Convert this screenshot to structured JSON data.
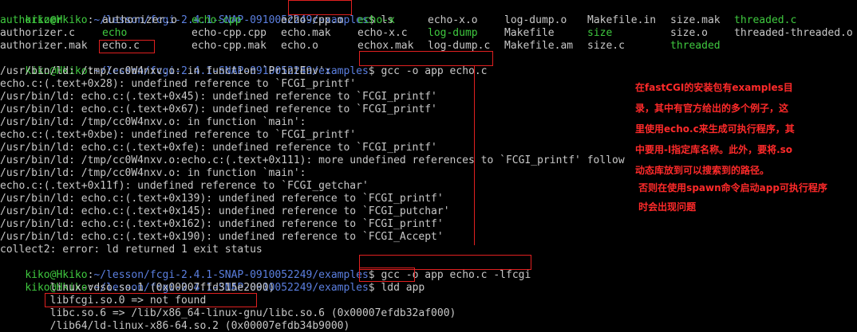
{
  "terminal": {
    "prompt1": {
      "user": "kiko@Hkiko",
      "sep": ":",
      "path": "~/lesson/fcgi-2.4.1-SNAP-0910052249/",
      "path_hl": "examples",
      "dollar": "$ ",
      "cmd": "ls"
    },
    "ls_rows": [
      [
        "authorizer",
        "authorizer.o",
        "echo-cpp",
        "echo-cpp.o",
        "echo-x",
        "echo-x.o",
        "log-dump.o",
        "Makefile.in",
        "size.mak",
        "threaded.c"
      ],
      [
        "authorizer.c",
        "echo",
        "echo-cpp.cpp",
        "echo.mak",
        "echo-x.c",
        "log-dump",
        "Makefile",
        "size",
        "size.o",
        "threaded-threaded.o"
      ],
      [
        "authorizer.mak",
        "echo.c",
        "echo-cpp.mak",
        "echo.o",
        "echox.mak",
        "log-dump.c",
        "Makefile.am",
        "size.c",
        "threaded",
        ""
      ]
    ],
    "prompt2": {
      "user": "kiko@Hkiko",
      "sep": ":",
      "path": "~/lesson/fcgi-2.4.1-SNAP-0910052249/examples",
      "dollar": "$ ",
      "cmd": "gcc -o app echo.c"
    },
    "errors": [
      "/usr/bin/ld: /tmp/cc0W4nxv.o: in function `PrintEnv':",
      "echo.c:(.text+0x28): undefined reference to `FCGI_printf'",
      "/usr/bin/ld: echo.c:(.text+0x45): undefined reference to `FCGI_printf'",
      "/usr/bin/ld: echo.c:(.text+0x67): undefined reference to `FCGI_printf'",
      "/usr/bin/ld: /tmp/cc0W4nxv.o: in function `main':",
      "echo.c:(.text+0xbe): undefined reference to `FCGI_printf'",
      "/usr/bin/ld: echo.c:(.text+0xfe): undefined reference to `FCGI_printf'",
      "/usr/bin/ld: /tmp/cc0W4nxv.o:echo.c:(.text+0x111): more undefined references to `FCGI_printf' follow",
      "/usr/bin/ld: /tmp/cc0W4nxv.o: in function `main':",
      "echo.c:(.text+0x11f): undefined reference to `FCGI_getchar'",
      "/usr/bin/ld: echo.c:(.text+0x139): undefined reference to `FCGI_printf'",
      "/usr/bin/ld: echo.c:(.text+0x145): undefined reference to `FCGI_putchar'",
      "/usr/bin/ld: echo.c:(.text+0x162): undefined reference to `FCGI_printf'",
      "/usr/bin/ld: echo.c:(.text+0x190): undefined reference to `FCGI_Accept'",
      "collect2: error: ld returned 1 exit status"
    ],
    "prompt3": {
      "user": "kiko@Hkiko",
      "sep": ":",
      "path": "~/lesson/fcgi-2.4.1-SNAP-0910052249/examples",
      "dollar": "$ ",
      "cmd": "gcc -o app echo.c -lfcgi"
    },
    "prompt4": {
      "user": "kiko@Hkiko",
      "sep": ":",
      "path": "~/lesson/fcgi-2.4.1-SNAP-0910052249/examples",
      "dollar": "$ ",
      "cmd": "ldd app"
    },
    "ldd": [
      "        linux-vdso.so.1 (0x00007ffd315e2000)",
      "        libfcgi.so.0 => not found",
      "        libc.so.6 => /lib/x86_64-linux-gnu/libc.so.6 (0x00007efdb32af000)",
      "        /lib64/ld-linux-x86-64.so.2 (0x00007efdb34b9000)"
    ]
  },
  "annotation": {
    "lines": [
      "在fastCGI的安装包有examples目",
      "录，其中有官方给出的多个例子，这",
      "里使用echo.c来生成可执行程序，其",
      "中要用-l指定库名称。此外，要将.so",
      "动态库放到可以搜索到的路径。",
      " 否则在使用spawn命令启动app可执行程序",
      " 时会出现问题"
    ],
    "color": "#ff2a2a"
  },
  "colors": {
    "prompt_green": "#3fc93f",
    "path_blue": "#5b7fe0",
    "text": "#c8c8c8",
    "highlight_red": "#e02020",
    "background": "#000000"
  }
}
